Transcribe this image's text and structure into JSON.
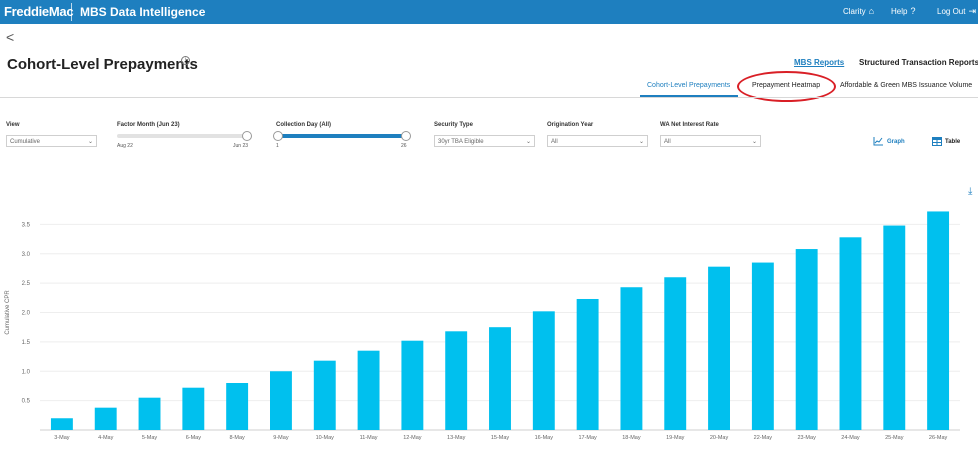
{
  "header": {
    "brand": "FreddieMac",
    "app_title": "MBS Data Intelligence",
    "nav": [
      {
        "label": "Clarity",
        "icon": "home-icon",
        "glyph": "⌂"
      },
      {
        "label": "Help",
        "icon": "help-icon",
        "glyph": "?"
      },
      {
        "label": "Log Out",
        "icon": "logout-icon",
        "glyph": "⇥"
      }
    ]
  },
  "page": {
    "back_glyph": "<",
    "title": "Cohort-Level Prepayments",
    "info_glyph": "i",
    "links": {
      "mbs_reports": "MBS Reports",
      "structured": "Structured Transaction Reports"
    },
    "tabs": [
      "Cohort-Level Prepayments",
      "Prepayment Heatmap",
      "Affordable & Green MBS Issuance Volume"
    ],
    "active_tab": "Cohort-Level Prepayments"
  },
  "filters": {
    "view": {
      "label": "View",
      "value": "Cumulative"
    },
    "factor_month": {
      "label": "Factor Month (Jun 23)",
      "min_label": "Aug 22",
      "max_label": "Jun 23"
    },
    "collection_day": {
      "label": "Collection Day (All)",
      "min_label": "1",
      "max_label": "26"
    },
    "security_type": {
      "label": "Security Type",
      "value": "30yr TBA Eligible"
    },
    "origination_year": {
      "label": "Origination Year",
      "value": "All"
    },
    "wa_net_interest_rate": {
      "label": "WA Net Interest Rate",
      "value": "All"
    },
    "chevron": "⌄"
  },
  "view_toggle": {
    "graph": "Graph",
    "table": "Table",
    "active": "graph"
  },
  "download_glyph": "⤓",
  "colors": {
    "brand": "#1e7fbf",
    "bar": "#00c0ee",
    "highlight": "#d91f26"
  },
  "chart_data": {
    "type": "bar",
    "categories": [
      "3-May",
      "4-May",
      "5-May",
      "6-May",
      "8-May",
      "9-May",
      "10-May",
      "11-May",
      "12-May",
      "13-May",
      "15-May",
      "16-May",
      "17-May",
      "18-May",
      "19-May",
      "20-May",
      "22-May",
      "23-May",
      "24-May",
      "25-May",
      "26-May"
    ],
    "values": [
      0.2,
      0.38,
      0.55,
      0.72,
      0.8,
      1.0,
      1.18,
      1.35,
      1.52,
      1.68,
      1.75,
      2.02,
      2.23,
      2.43,
      2.6,
      2.78,
      2.85,
      3.08,
      3.28,
      3.48,
      3.72
    ],
    "ylabel": "Cumulative CPR",
    "yticks": [
      0.5,
      1.0,
      1.5,
      2.0,
      2.5,
      3.0,
      3.5
    ],
    "ytick_labels": [
      "0.5",
      "1.0",
      "1.5",
      "2.0",
      "2.5",
      "3.0",
      "3.5"
    ],
    "ylim": [
      0,
      4
    ],
    "grid": true
  }
}
